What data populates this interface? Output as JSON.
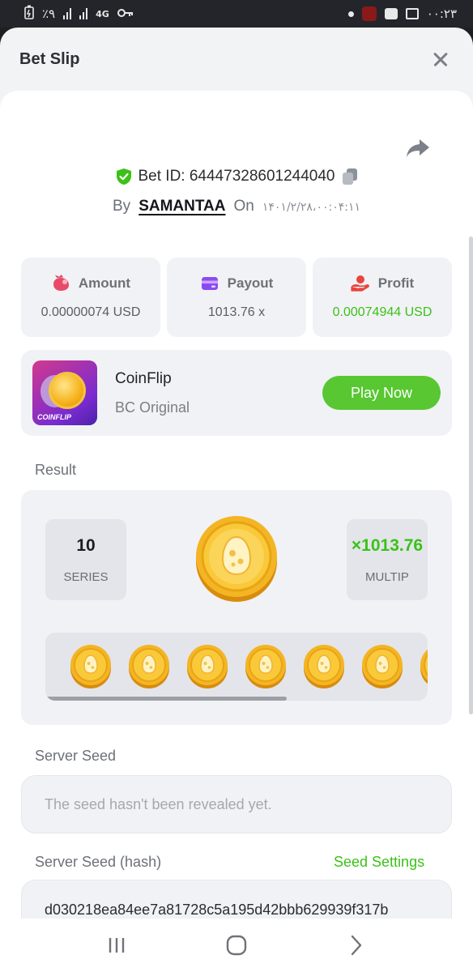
{
  "status_bar": {
    "left_text": "٪۹",
    "network": "4G",
    "time": "۰۰:۲۳"
  },
  "sheet": {
    "title": "Bet Slip"
  },
  "bet": {
    "id_label": "Bet ID: 64447328601244040",
    "by_label": "By",
    "user": "SAMANTAA",
    "on_label": "On",
    "date": "۱۴۰۱/۲/۲۸،۰۰:۰۴:۱۱"
  },
  "stats": [
    {
      "label": "Amount",
      "value": "0.00000074 USD",
      "icon": "bag-icon"
    },
    {
      "label": "Payout",
      "value": "1013.76 x",
      "icon": "wallet-icon"
    },
    {
      "label": "Profit",
      "value": "0.00074944 USD",
      "icon": "hand-coin-icon"
    }
  ],
  "game": {
    "thumb_label": "COINFLIP",
    "name": "CoinFlip",
    "subtitle": "BC Original",
    "play_label": "Play Now"
  },
  "result": {
    "section_label": "Result",
    "series_value": "10",
    "series_label": "SERIES",
    "multiplier_value": "×1013.76",
    "multiplier_label": "MULTIP",
    "coin_count_visible": 7
  },
  "server_seed": {
    "label": "Server Seed",
    "placeholder": "The seed hasn't been revealed yet."
  },
  "server_seed_hash": {
    "label": "Server Seed (hash)",
    "settings_label": "Seed Settings",
    "value": "d030218ea84ee7a81728c5a195d42bbb629939f317b"
  },
  "colors": {
    "accent_green": "#3bc117",
    "play_green": "#58c732",
    "panel_bg": "#f1f2f5"
  }
}
